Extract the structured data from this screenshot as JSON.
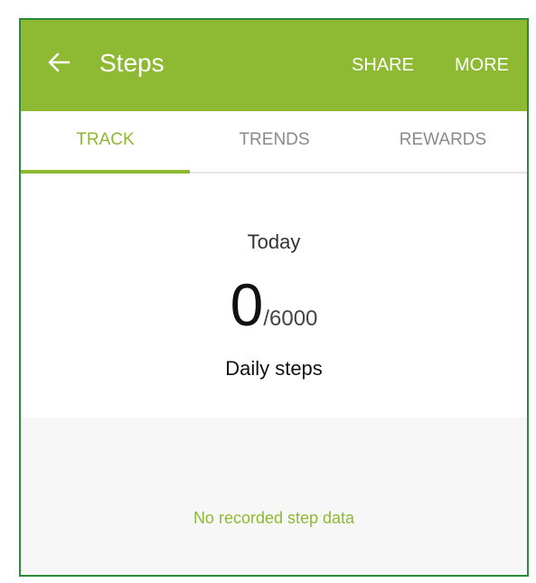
{
  "colors": {
    "accent": "#8dba32",
    "frame_border": "#2c8a3a",
    "inactive_tab": "#8a8a8a"
  },
  "appbar": {
    "back_icon": "arrow-left-icon",
    "title": "Steps",
    "share_label": "SHARE",
    "more_label": "MORE"
  },
  "tabs": [
    {
      "label": "TRACK",
      "active": true
    },
    {
      "label": "TRENDS",
      "active": false
    },
    {
      "label": "REWARDS",
      "active": false
    }
  ],
  "track": {
    "period_label": "Today",
    "steps_count": "0",
    "goal_text": "/6000",
    "steps_caption": "Daily steps",
    "empty_message": "No recorded step data"
  }
}
